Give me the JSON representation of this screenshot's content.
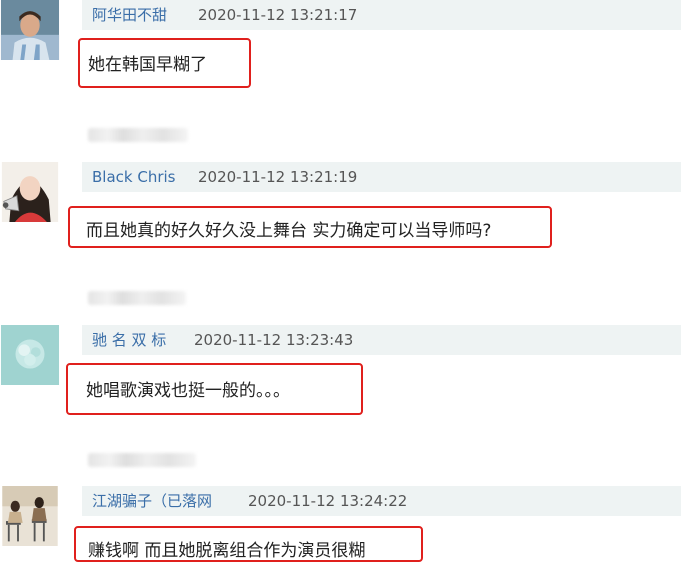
{
  "comments": [
    {
      "username": "阿华田不甜",
      "time": "2020-11-12 13:21:17",
      "text": "她在韩国早糊了",
      "avatar_icon": "footballer-photo-avatar"
    },
    {
      "username": "Black Chris",
      "time": "2020-11-12 13:21:19",
      "text": "而且她真的好久好久没上舞台 实力确定可以当导师吗?",
      "avatar_icon": "girl-with-megaphone-avatar"
    },
    {
      "username": "驰 名 双 标",
      "time": "2020-11-12 13:23:43",
      "text": "她唱歌演戏也挺一般的。。。",
      "avatar_icon": "teal-flower-avatar"
    },
    {
      "username": "江湖骗子（已落网",
      "time": "2020-11-12 13:24:22",
      "text": "赚钱啊 而且她脱离组合作为演员很糊",
      "avatar_icon": "people-on-chairs-avatar"
    }
  ],
  "colors": {
    "highlight_border": "#e0201d",
    "username": "#3a6ea8",
    "header_bg": "#eef3f3"
  }
}
